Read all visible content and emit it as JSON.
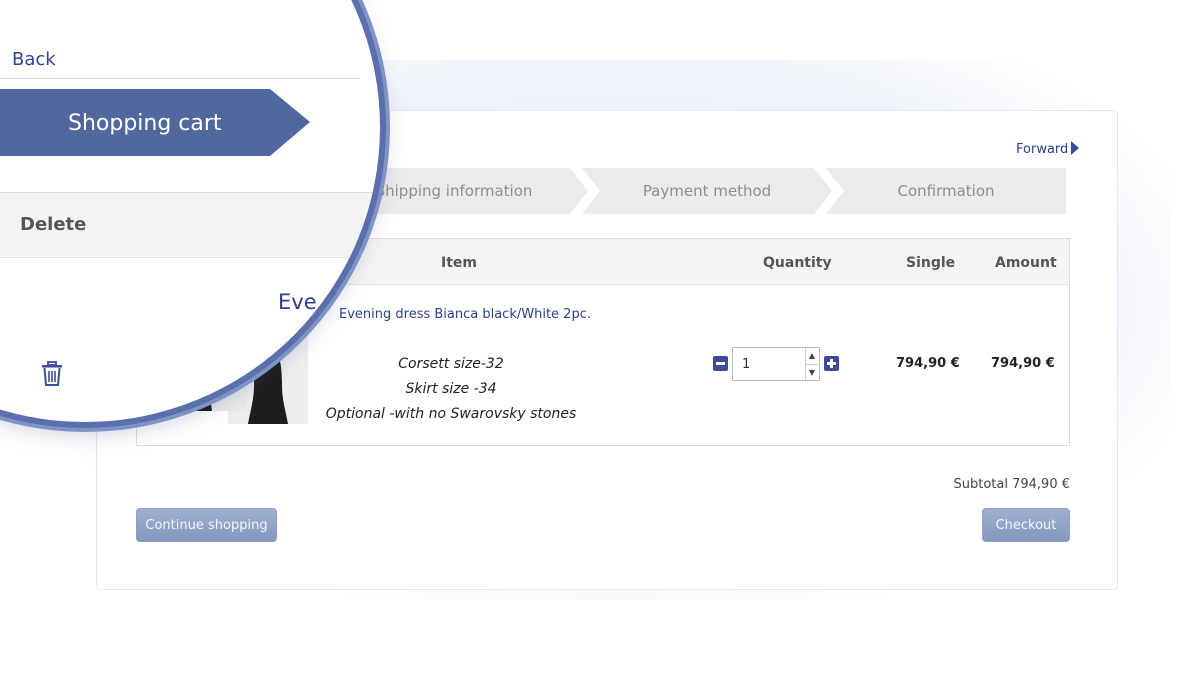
{
  "nav": {
    "forward": "Forward",
    "back": "Back"
  },
  "steps": [
    "Shopping cart",
    "Shipping information",
    "Payment method",
    "Confirmation"
  ],
  "table": {
    "headers": {
      "delete": "Delete",
      "item": "Item",
      "quantity": "Quantity",
      "single": "Single",
      "amount": "Amount"
    },
    "rows": [
      {
        "title": "Evening dress Bianca black/White 2pc.",
        "title_magnified": "Eve",
        "options": [
          "Corsett size-32",
          "Skirt size -34",
          "Optional -with no Swarovsky stones"
        ],
        "quantity": "1",
        "single": "794,90 €",
        "amount": "794,90 €"
      }
    ]
  },
  "summary": {
    "subtotal": "Subtotal 794,90 €"
  },
  "buttons": {
    "continue": "Continue shopping",
    "checkout": "Checkout"
  },
  "icons": {
    "delete": "trash-icon",
    "forward": "forward-arrow-icon",
    "minus": "minus-icon",
    "plus": "plus-icon"
  },
  "colors": {
    "accent": "#51689f",
    "link": "#2e3f86",
    "button": "#8fa0c7"
  }
}
